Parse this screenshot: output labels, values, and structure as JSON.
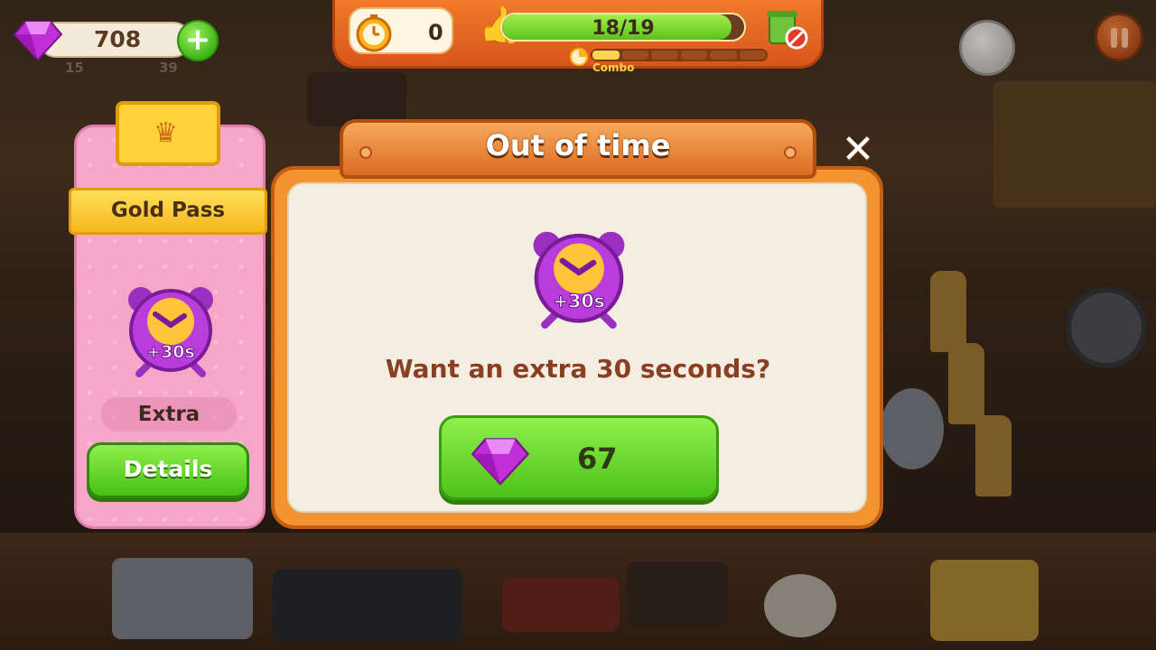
{
  "hud": {
    "gems": "708",
    "gem_add_icon": "plus-icon",
    "sub_count_left": "15",
    "sub_count_right": "39",
    "timer_value": "0",
    "progress_text": "18/19",
    "progress_fraction": 0.947,
    "combo_label": "Combo",
    "combo_segments_filled": 1,
    "combo_segments_total": 6
  },
  "gold_pass": {
    "title": "Gold Pass",
    "badge_text": "+30s",
    "label": "Extra",
    "details_button": "Details"
  },
  "dialog": {
    "title": "Out of time",
    "badge_text": "+30s",
    "question": "Want an extra 30 seconds?",
    "price": "67"
  },
  "colors": {
    "dialog_orange": "#f39431",
    "button_green": "#4ec218",
    "gem_purple": "#c12fd8",
    "card_pink": "#f6a7c7",
    "banner_gold": "#ffd23a",
    "title_text": "#8a3f22"
  }
}
